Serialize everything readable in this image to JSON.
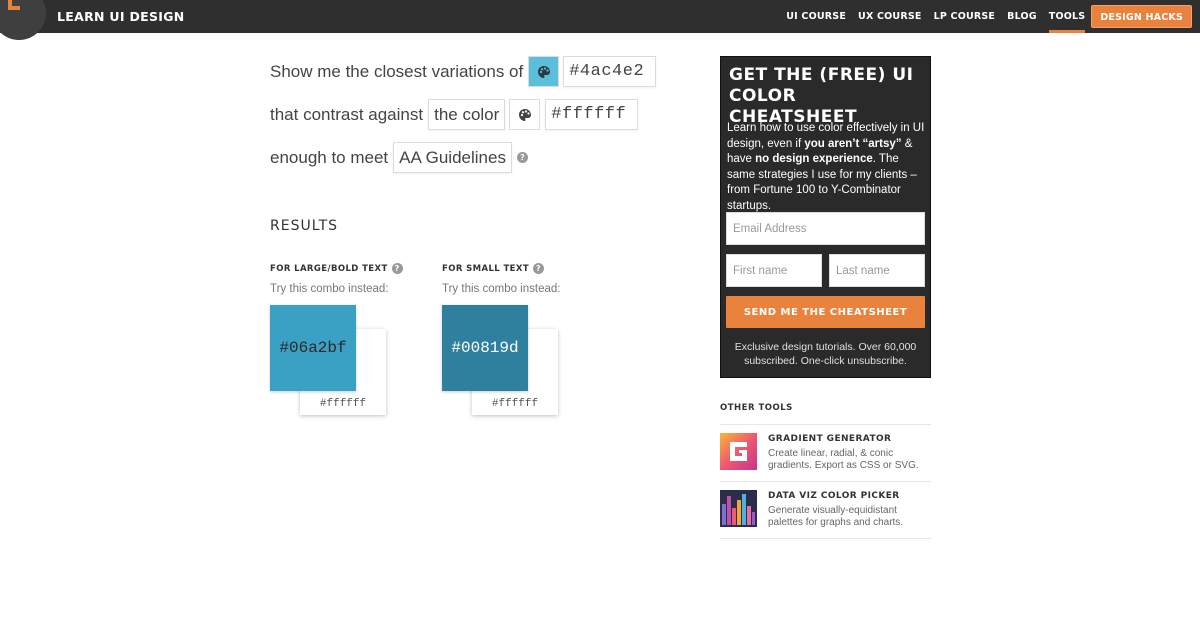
{
  "header": {
    "brand": "LEARN UI DESIGN",
    "nav": [
      "UI COURSE",
      "UX COURSE",
      "LP COURSE",
      "BLOG",
      "TOOLS"
    ],
    "cta": "DESIGN HACKS"
  },
  "form": {
    "line1_prefix": "Show me the closest variations of",
    "color_input": "#4ac4e2",
    "color_swatch": "#4ac4e2",
    "line2_prefix": "that contrast against",
    "contrast_mode": "the color",
    "bg_input": "#ffffff",
    "line3_prefix": "enough to meet",
    "guideline": "AA Guidelines"
  },
  "results": {
    "heading": "RESULTS",
    "large": {
      "title": "FOR LARGE/BOLD TEXT",
      "sub": "Try this combo instead:",
      "fg": "#06a2bf",
      "fg_color": "#3aa0c4",
      "bg": "#ffffff"
    },
    "small": {
      "title": "FOR SMALL TEXT",
      "sub": "Try this combo instead:",
      "fg": "#00819d",
      "fg_color": "#2f7f9e",
      "bg": "#ffffff"
    }
  },
  "cheatsheet": {
    "title": "GET THE (FREE) UI COLOR CHEATSHEET",
    "body_1": "Learn how to use color effectively in UI design, even if ",
    "body_bold_1": "you aren’t “artsy”",
    "body_2": " & have ",
    "body_bold_2": "no design experience",
    "body_3": ". The same strategies I use for my clients – from Fortune 100 to Y-Combinator startups.",
    "email_placeholder": "Email Address",
    "first_placeholder": "First name",
    "last_placeholder": "Last name",
    "button": "SEND ME THE CHEATSHEET",
    "footer": "Exclusive design tutorials. Over 60,000 subscribed. One-click unsubscribe."
  },
  "other_tools": {
    "heading": "OTHER TOOLS",
    "items": [
      {
        "title": "GRADIENT GENERATOR",
        "desc": "Create linear, radial, & conic gradients. Export as CSS or SVG.",
        "icon": "gradient-icon"
      },
      {
        "title": "DATA VIZ COLOR PICKER",
        "desc": "Generate visually-equidistant palettes for graphs and charts.",
        "icon": "bar-palette-icon"
      }
    ]
  },
  "colors": {
    "accent": "#e8823d",
    "header_bg": "#2f2f2f",
    "sidebar_bg": "#2a2a2a"
  }
}
